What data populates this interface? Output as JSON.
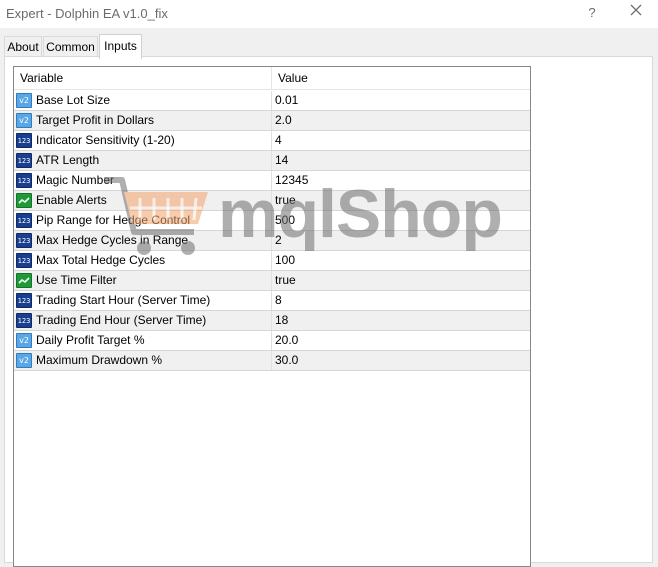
{
  "window": {
    "title": "Expert - Dolphin EA v1.0_fix",
    "help_label": "?",
    "close_icon": "close-icon"
  },
  "tabs": [
    {
      "label": "About",
      "active": false
    },
    {
      "label": "Common",
      "active": false
    },
    {
      "label": "Inputs",
      "active": true
    }
  ],
  "table": {
    "headers": {
      "variable": "Variable",
      "value": "Value"
    },
    "rows": [
      {
        "type": "double",
        "icon": "v2",
        "variable": "Base Lot Size",
        "value": "0.01"
      },
      {
        "type": "double",
        "icon": "v2",
        "variable": "Target Profit in Dollars",
        "value": "2.0"
      },
      {
        "type": "int",
        "icon": "123",
        "variable": "Indicator Sensitivity (1-20)",
        "value": "4"
      },
      {
        "type": "int",
        "icon": "123",
        "variable": "ATR Length",
        "value": "14"
      },
      {
        "type": "int",
        "icon": "123",
        "variable": "Magic Number",
        "value": "12345"
      },
      {
        "type": "bool",
        "icon": "bool-icon",
        "variable": "Enable Alerts",
        "value": "true"
      },
      {
        "type": "int",
        "icon": "123",
        "variable": "Pip Range for Hedge Control",
        "value": "500"
      },
      {
        "type": "int",
        "icon": "123",
        "variable": "Max Hedge Cycles in Range",
        "value": "2"
      },
      {
        "type": "int",
        "icon": "123",
        "variable": "Max Total Hedge Cycles",
        "value": "100"
      },
      {
        "type": "bool",
        "icon": "bool-icon",
        "variable": "Use Time Filter",
        "value": "true"
      },
      {
        "type": "int",
        "icon": "123",
        "variable": "Trading Start Hour (Server Time)",
        "value": "8"
      },
      {
        "type": "int",
        "icon": "123",
        "variable": "Trading End Hour (Server Time)",
        "value": "18"
      },
      {
        "type": "double",
        "icon": "v2",
        "variable": "Daily Profit Target %",
        "value": "20.0"
      },
      {
        "type": "double",
        "icon": "v2",
        "variable": "Maximum Drawdown %",
        "value": "30.0"
      }
    ]
  },
  "watermark": {
    "text": "mqlShop",
    "accent": "#f2a36b",
    "text_color": "#6e6e6e"
  }
}
